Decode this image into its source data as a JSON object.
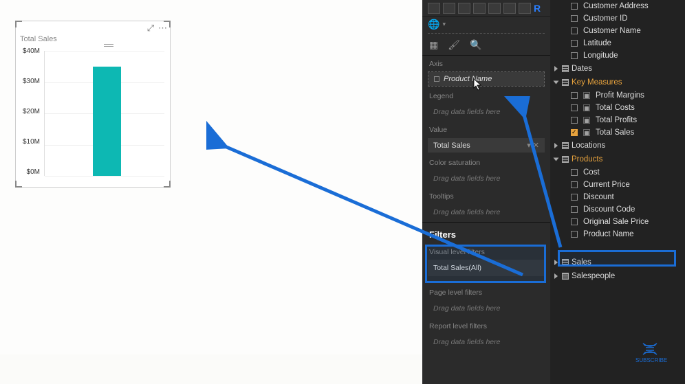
{
  "visual": {
    "title": "Total Sales",
    "y_ticks": [
      "$40M",
      "$30M",
      "$20M",
      "$10M",
      "$0M"
    ],
    "chart_data": {
      "type": "bar",
      "categories": [
        ""
      ],
      "values": [
        35000000
      ],
      "ylabel": "",
      "ylim": [
        0,
        40000000
      ],
      "title": "Total Sales"
    }
  },
  "viz_pane": {
    "tabs": {
      "fields": "▦",
      "format": "🖌",
      "analytics": "🔍"
    },
    "wells": {
      "axis": {
        "label": "Axis",
        "item": "Product Name"
      },
      "legend": {
        "label": "Legend",
        "placeholder": "Drag data fields here"
      },
      "value": {
        "label": "Value",
        "item": "Total Sales"
      },
      "color": {
        "label": "Color saturation",
        "placeholder": "Drag data fields here"
      },
      "tooltips": {
        "label": "Tooltips",
        "placeholder": "Drag data fields here"
      }
    },
    "filters": {
      "header": "Filters",
      "visual": {
        "label": "Visual level filters",
        "item": "Total Sales(All)"
      },
      "page": {
        "label": "Page level filters",
        "placeholder": "Drag data fields here"
      },
      "report": {
        "label": "Report level filters",
        "placeholder": "Drag data fields here"
      }
    }
  },
  "fields": {
    "customers": [
      "Customer Address",
      "Customer ID",
      "Customer Name",
      "Latitude",
      "Longitude"
    ],
    "dates_label": "Dates",
    "key_measures": {
      "label": "Key Measures",
      "items": [
        "Profit Margins",
        "Total Costs",
        "Total Profits",
        "Total Sales"
      ],
      "checked": "Total Sales"
    },
    "locations_label": "Locations",
    "products": {
      "label": "Products",
      "items": [
        "Cost",
        "Current Price",
        "Discount",
        "Discount Code",
        "Original Sale Price",
        "Product Name"
      ]
    },
    "sales_label": "Sales",
    "salespeople_label": "Salespeople"
  },
  "subscribe": "SUBSCRIBE"
}
